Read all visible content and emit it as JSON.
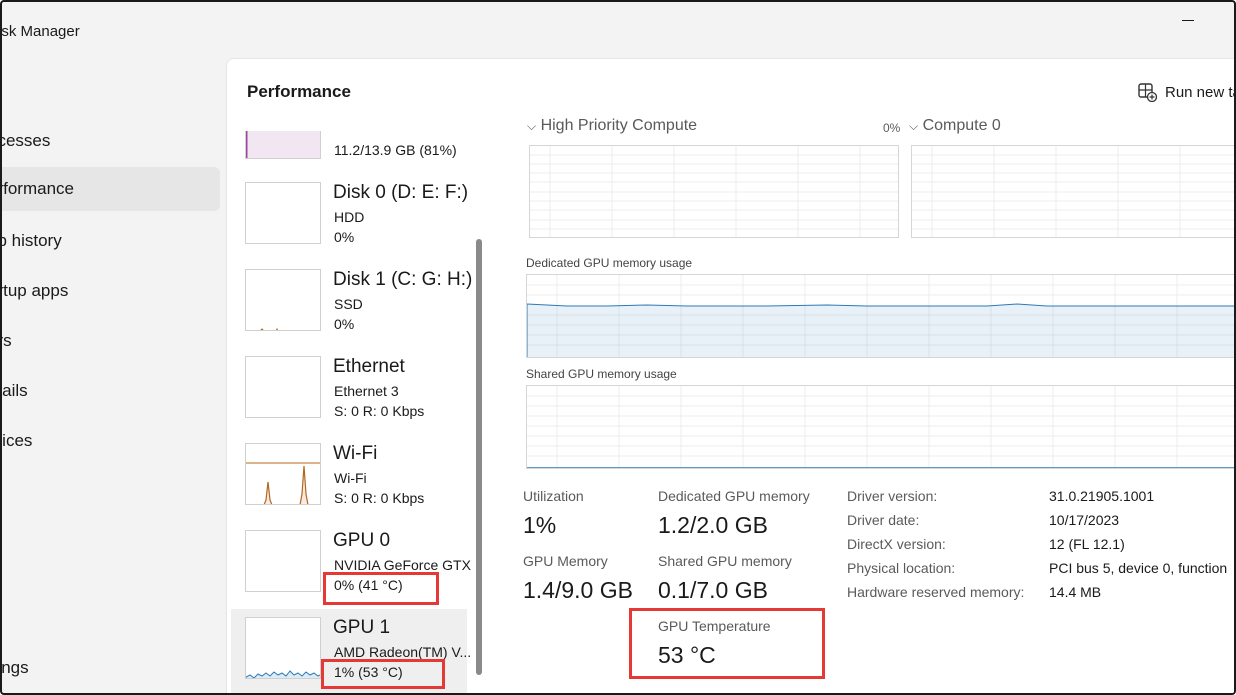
{
  "window": {
    "title": "ask Manager"
  },
  "nav": {
    "items": [
      {
        "label": "ocesses"
      },
      {
        "label": "erformance"
      },
      {
        "label": "op history"
      },
      {
        "label": "artup apps"
      },
      {
        "label": "ers"
      },
      {
        "label": "etails"
      },
      {
        "label": "rvices"
      }
    ],
    "settings": "ttings"
  },
  "header": {
    "title": "Performance",
    "run_task": "Run new ta"
  },
  "devices": [
    {
      "name": "",
      "sub": "11.2/13.9 GB (81%)",
      "value": ""
    },
    {
      "name": "Disk 0 (D: E: F:)",
      "sub": "HDD",
      "value": "0%"
    },
    {
      "name": "Disk 1 (C: G: H:)",
      "sub": "SSD",
      "value": "0%"
    },
    {
      "name": "Ethernet",
      "sub": "Ethernet 3",
      "value": "S: 0 R: 0 Kbps"
    },
    {
      "name": "Wi-Fi",
      "sub": "Wi-Fi",
      "value": "S: 0 R: 0 Kbps"
    },
    {
      "name": "GPU 0",
      "sub": "NVIDIA GeForce GTX",
      "value": "0% (41 °C)"
    },
    {
      "name": "GPU 1",
      "sub": "AMD Radeon(TM) V...",
      "value": "1% (53 °C)"
    }
  ],
  "graphs": {
    "engine_left": {
      "title": "High Priority Compute",
      "pct": "0%"
    },
    "engine_right": {
      "title": "Compute 0"
    },
    "dedicated_label": "Dedicated GPU memory usage",
    "shared_label": "Shared GPU memory usage"
  },
  "stats": {
    "utilization": {
      "label": "Utilization",
      "value": "1%"
    },
    "dedicated": {
      "label": "Dedicated GPU memory",
      "value": "1.2/2.0 GB"
    },
    "gpu_memory": {
      "label": "GPU Memory",
      "value": "1.4/9.0 GB"
    },
    "shared": {
      "label": "Shared GPU memory",
      "value": "0.1/7.0 GB"
    },
    "temperature": {
      "label": "GPU Temperature",
      "value": "53 °C"
    }
  },
  "info": [
    {
      "label": "Driver version:",
      "value": "31.0.21905.1001"
    },
    {
      "label": "Driver date:",
      "value": "10/17/2023"
    },
    {
      "label": "DirectX version:",
      "value": "12 (FL 12.1)"
    },
    {
      "label": "Physical location:",
      "value": "PCI bus 5, device 0, function"
    },
    {
      "label": "Hardware reserved memory:",
      "value": "14.4 MB"
    }
  ],
  "colors": {
    "highlight": "#e53935",
    "gpu_line": "#2a7ab8",
    "wifi_line": "#b5651d",
    "memory_line": "#9b4a9e"
  }
}
